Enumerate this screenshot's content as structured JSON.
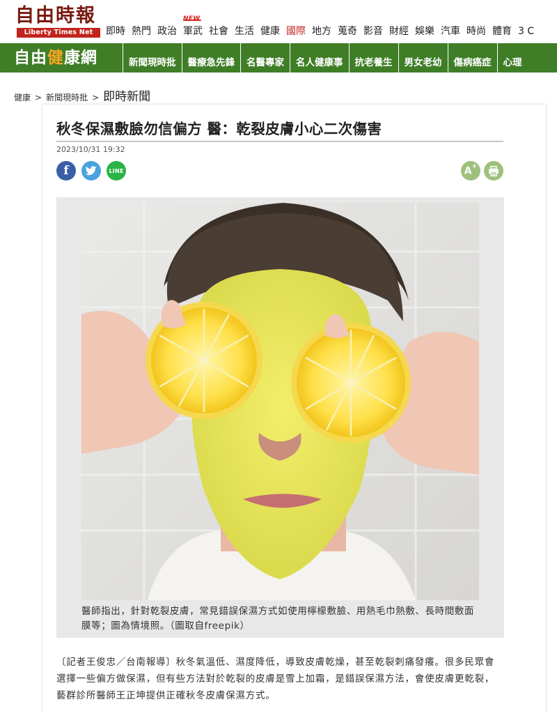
{
  "header": {
    "logo_cn": "自由時報",
    "logo_en": "Liberty Times Net",
    "new_badge": "NEW",
    "nav": [
      {
        "label": "即時",
        "active": false
      },
      {
        "label": "熱門",
        "active": false
      },
      {
        "label": "政治",
        "active": false
      },
      {
        "label": "軍武",
        "active": false
      },
      {
        "label": "社會",
        "active": false
      },
      {
        "label": "生活",
        "active": false
      },
      {
        "label": "健康",
        "active": false
      },
      {
        "label": "國際",
        "active": true
      },
      {
        "label": "地方",
        "active": false
      },
      {
        "label": "蒐奇",
        "active": false
      },
      {
        "label": "影音",
        "active": false
      },
      {
        "label": "財經",
        "active": false
      },
      {
        "label": "娛樂",
        "active": false
      },
      {
        "label": "汽車",
        "active": false
      },
      {
        "label": "時尚",
        "active": false
      },
      {
        "label": "體育",
        "active": false
      },
      {
        "label": "3 C",
        "active": false
      }
    ],
    "active_color": "#c2231c"
  },
  "section": {
    "logo_part1": "自由",
    "logo_accent": "健",
    "logo_part2": "康網",
    "nav": [
      "新聞現時批",
      "醫療急先鋒",
      "名醫專家",
      "名人健康事",
      "抗老養生",
      "男女老幼",
      "傷病癌症",
      "心理"
    ],
    "bar_color": "#3f7e27"
  },
  "breadcrumb": {
    "items": [
      "健康",
      "新聞現時批"
    ],
    "separator": ">",
    "current": "即時新聞"
  },
  "article": {
    "title": "秋冬保濕敷臉勿信偏方 醫：乾裂皮膚小心二次傷害",
    "date": "2023/10/31 19:32",
    "share": {
      "facebook": "f",
      "line": "LINE"
    },
    "tools": {
      "font_size": "A",
      "font_plus": "+"
    },
    "caption": "醫師指出，針對乾裂皮膚，常見錯誤保濕方式如使用檸檬敷臉、用熱毛巾熱敷、長時間敷面膜等；圖為情境照。（圖取自freepik）",
    "body": "〔記者王俊忠／台南報導〕秋冬氣溫低、濕度降低，導致皮膚乾燥，甚至乾裂刺痛發癢。很多民眾會選擇一些偏方做保濕，但有些方法對於乾裂的皮膚是雪上加霜，是錯誤保濕方法，會使皮膚更乾裂，藝群診所醫師王正坤提供正確秋冬皮膚保濕方式。"
  },
  "icons": [
    "facebook-icon",
    "twitter-icon",
    "line-icon",
    "font-size-icon",
    "print-icon"
  ]
}
